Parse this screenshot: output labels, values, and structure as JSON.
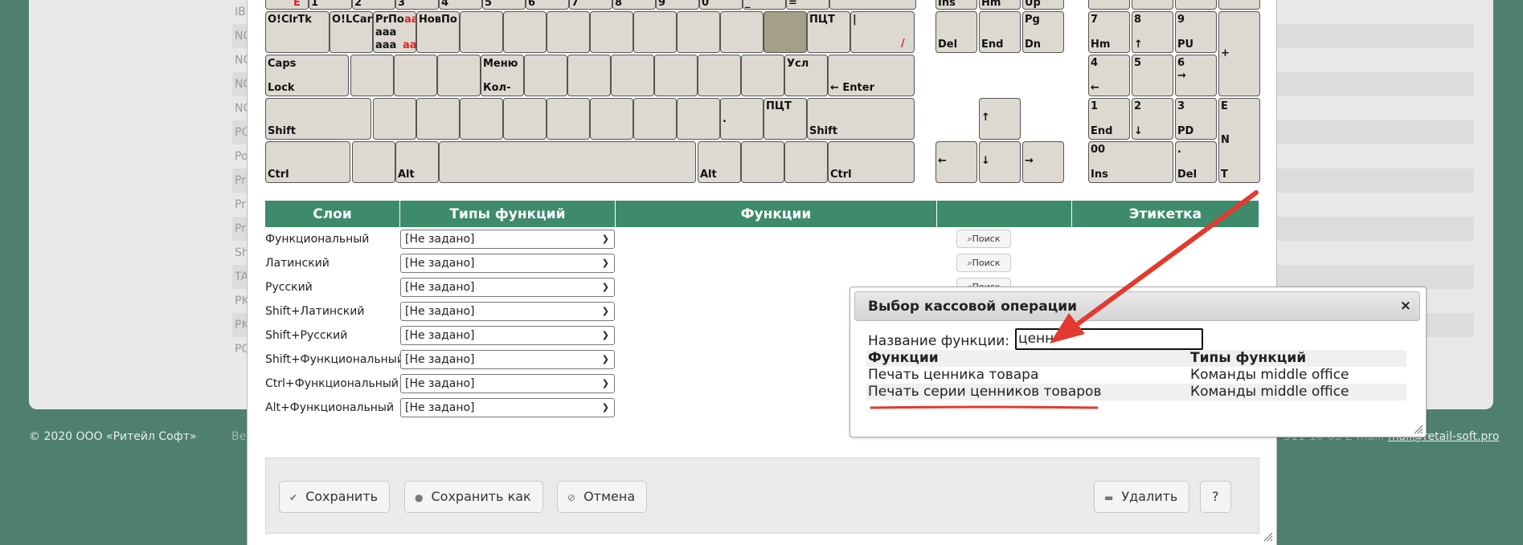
{
  "background": {
    "rows": [
      "IB",
      "NC",
      "NC",
      "NC",
      "NC",
      "PO",
      "Po",
      "Pr",
      "Pr",
      "Pr",
      "Sh",
      "TA",
      "PK",
      "PK",
      "PO"
    ],
    "footer_copyright": "© 2020 ООО «Ритейл Софт»",
    "footer_mid": "Ве",
    "footer_phone": "-311-10-05",
    "footer_email_label": "E-mail:",
    "footer_email": "mail@retail-soft.pro"
  },
  "keyboard": {
    "row0": [
      "E",
      "1",
      "2",
      "3",
      "4",
      "5",
      "6",
      "7",
      "8",
      "9",
      "0",
      "_",
      "=",
      "Ins",
      "Hm",
      "Up"
    ],
    "row1": {
      "k1": "O!ClrTk",
      "k2": "O!LCar",
      "k3_top": "PrПо",
      "k3_red": "аа",
      "k3_mid": "aaa",
      "k3_bot": "aaa",
      "k3_botred": "aa",
      "k4": "НовПо",
      "pct": "ПЦТ",
      "pipe": "|",
      "slash": "/"
    },
    "row2": {
      "caps_top": "Caps",
      "caps_bot": "Lock",
      "menu_top": "Меню",
      "menu_bot": "Кол-",
      "usl": "Усл",
      "enter": "← Enter"
    },
    "row3": {
      "shift_l": "Shift",
      "dot": ".",
      "pct": "ПЦТ",
      "shift_r": "Shift"
    },
    "row4": {
      "ctrl_l": "Ctrl",
      "alt_l": "Alt",
      "alt_r": "Alt",
      "ctrl_r": "Ctrl"
    },
    "nav": {
      "del": "Del",
      "end": "End",
      "pg": "Pg",
      "dn": "Dn",
      "up": "↑",
      "left": "←",
      "down": "↓",
      "right": "→"
    },
    "numpad": {
      "n7": "7",
      "n7b": "Hm",
      "n8": "8",
      "n8b": "↑",
      "n9": "9",
      "n9b": "PU",
      "plus": "+",
      "n4": "4",
      "n4b": "←",
      "n5": "5",
      "n6": "6",
      "n6b": "→",
      "n1": "1",
      "n1b": "End",
      "n2": "2",
      "n2b": "↓",
      "n3": "3",
      "n3b": "PD",
      "e1": "E",
      "e2": "N",
      "e3": "T",
      "n0": "00",
      "n0b": "Ins",
      "dot": ".",
      "dotb": "Del"
    }
  },
  "layers_table": {
    "headers": [
      "Слои",
      "Типы функций",
      "Функции",
      "",
      "Этикетка"
    ],
    "rows": [
      {
        "name": "Функциональный",
        "type": "[Не задано]",
        "search": "Поиск"
      },
      {
        "name": "Латинский",
        "type": "[Не задано]",
        "search": "Поиск"
      },
      {
        "name": "Русский",
        "type": "[Не задано]",
        "search": "Поиск"
      },
      {
        "name": "Shift+Латинский",
        "type": "[Не задано]",
        "search": ""
      },
      {
        "name": "Shift+Русский",
        "type": "[Не задано]",
        "search": ""
      },
      {
        "name": "Shift+Функциональный",
        "type": "[Не задано]",
        "search": ""
      },
      {
        "name": "Ctrl+Функциональный",
        "type": "[Не задано]",
        "search": ""
      },
      {
        "name": "Alt+Функциональный",
        "type": "[Не задано]",
        "search": ""
      }
    ]
  },
  "buttons": {
    "save": "Сохранить",
    "save_as": "Сохранить как",
    "cancel": "Отмена",
    "delete": "Удалить",
    "help": "?"
  },
  "popup": {
    "title": "Выбор кассовой операции",
    "close": "×",
    "field_label": "Название функции:",
    "field_value": "ценн",
    "col_functions": "Функции",
    "col_types": "Типы функций",
    "results": [
      {
        "function": "Печать ценника товара",
        "type": "Команды middle office"
      },
      {
        "function": "Печать серии ценников товаров",
        "type": "Команды middle office"
      }
    ]
  },
  "colors": {
    "header_green": "#3d8b6b",
    "key_fill": "#ddd9d0",
    "annotation_red": "#e23a2e"
  }
}
